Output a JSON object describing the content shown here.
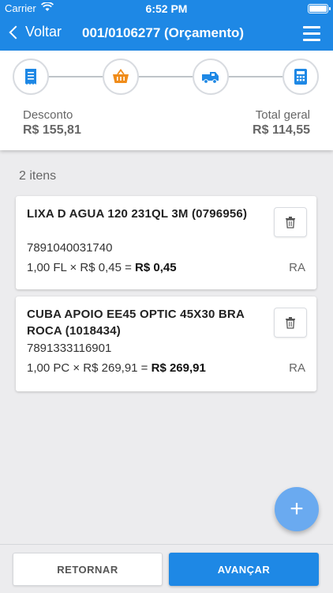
{
  "status_bar": {
    "carrier": "Carrier",
    "time": "6:52 PM"
  },
  "nav": {
    "back_label": "Voltar",
    "title": "001/0106277 (Orçamento)"
  },
  "summary": {
    "discount_label": "Desconto",
    "discount_value": "R$ 155,81",
    "total_label": "Total geral",
    "total_value": "R$ 114,55"
  },
  "steps": [
    {
      "icon": "receipt-icon",
      "color": "#1e88e5"
    },
    {
      "icon": "basket-icon",
      "color": "#f08c1a"
    },
    {
      "icon": "delivery-truck-icon",
      "color": "#1e88e5"
    },
    {
      "icon": "calculator-icon",
      "color": "#1e88e5"
    }
  ],
  "items_count": "2 itens",
  "items": [
    {
      "name": "LIXA D AGUA 120 231QL 3M (0796956)",
      "barcode": "7891040031740",
      "calc_prefix": "1,00 FL × R$ 0,45 = ",
      "calc_total": "R$ 0,45",
      "tag": "RA"
    },
    {
      "name": "CUBA APOIO EE45 OPTIC 45X30 BRA ROCA (1018434)",
      "barcode": "7891333116901",
      "calc_prefix": "1,00 PC × R$ 269,91 = ",
      "calc_total": "R$ 269,91",
      "tag": "RA"
    }
  ],
  "fab_label": "+",
  "buttons": {
    "back": "RETORNAR",
    "next": "AVANÇAR"
  },
  "colors": {
    "primary": "#1e88e5",
    "accent_orange": "#f08c1a",
    "fab": "#6aaaf0"
  }
}
